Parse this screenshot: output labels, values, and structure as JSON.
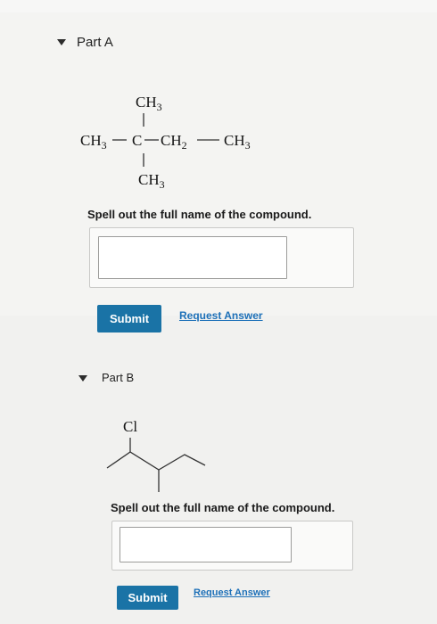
{
  "part_a": {
    "title": "Part A",
    "structure": {
      "top_group": "CH3",
      "main_chain": [
        "CH3",
        "C",
        "CH2",
        "CH3"
      ],
      "bottom_group": "CH3"
    },
    "question": "Spell out the full name of the compound.",
    "answer": {
      "value": "",
      "placeholder": ""
    },
    "submit_label": "Submit",
    "request_answer_label": "Request Answer"
  },
  "part_b": {
    "title": "Part B",
    "substituent_label": "Cl",
    "question": "Spell out the full name of the compound.",
    "answer": {
      "value": "",
      "placeholder": ""
    },
    "submit_label": "Submit",
    "request_answer_label": "Request Answer"
  }
}
